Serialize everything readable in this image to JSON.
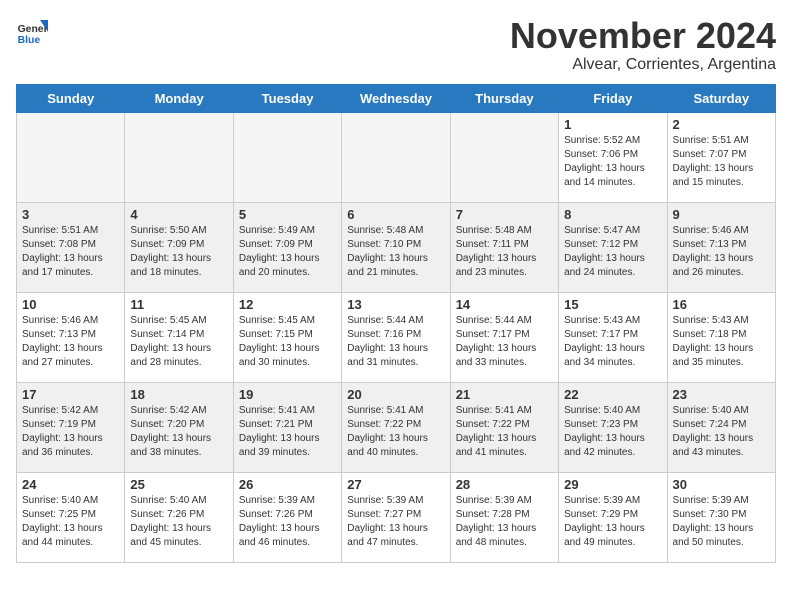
{
  "logo": {
    "general": "General",
    "blue": "Blue"
  },
  "title": "November 2024",
  "subtitle": "Alvear, Corrientes, Argentina",
  "days": [
    "Sunday",
    "Monday",
    "Tuesday",
    "Wednesday",
    "Thursday",
    "Friday",
    "Saturday"
  ],
  "weeks": [
    [
      {
        "day": "",
        "info": ""
      },
      {
        "day": "",
        "info": ""
      },
      {
        "day": "",
        "info": ""
      },
      {
        "day": "",
        "info": ""
      },
      {
        "day": "",
        "info": ""
      },
      {
        "day": "1",
        "info": "Sunrise: 5:52 AM\nSunset: 7:06 PM\nDaylight: 13 hours\nand 14 minutes."
      },
      {
        "day": "2",
        "info": "Sunrise: 5:51 AM\nSunset: 7:07 PM\nDaylight: 13 hours\nand 15 minutes."
      }
    ],
    [
      {
        "day": "3",
        "info": "Sunrise: 5:51 AM\nSunset: 7:08 PM\nDaylight: 13 hours\nand 17 minutes."
      },
      {
        "day": "4",
        "info": "Sunrise: 5:50 AM\nSunset: 7:09 PM\nDaylight: 13 hours\nand 18 minutes."
      },
      {
        "day": "5",
        "info": "Sunrise: 5:49 AM\nSunset: 7:09 PM\nDaylight: 13 hours\nand 20 minutes."
      },
      {
        "day": "6",
        "info": "Sunrise: 5:48 AM\nSunset: 7:10 PM\nDaylight: 13 hours\nand 21 minutes."
      },
      {
        "day": "7",
        "info": "Sunrise: 5:48 AM\nSunset: 7:11 PM\nDaylight: 13 hours\nand 23 minutes."
      },
      {
        "day": "8",
        "info": "Sunrise: 5:47 AM\nSunset: 7:12 PM\nDaylight: 13 hours\nand 24 minutes."
      },
      {
        "day": "9",
        "info": "Sunrise: 5:46 AM\nSunset: 7:13 PM\nDaylight: 13 hours\nand 26 minutes."
      }
    ],
    [
      {
        "day": "10",
        "info": "Sunrise: 5:46 AM\nSunset: 7:13 PM\nDaylight: 13 hours\nand 27 minutes."
      },
      {
        "day": "11",
        "info": "Sunrise: 5:45 AM\nSunset: 7:14 PM\nDaylight: 13 hours\nand 28 minutes."
      },
      {
        "day": "12",
        "info": "Sunrise: 5:45 AM\nSunset: 7:15 PM\nDaylight: 13 hours\nand 30 minutes."
      },
      {
        "day": "13",
        "info": "Sunrise: 5:44 AM\nSunset: 7:16 PM\nDaylight: 13 hours\nand 31 minutes."
      },
      {
        "day": "14",
        "info": "Sunrise: 5:44 AM\nSunset: 7:17 PM\nDaylight: 13 hours\nand 33 minutes."
      },
      {
        "day": "15",
        "info": "Sunrise: 5:43 AM\nSunset: 7:17 PM\nDaylight: 13 hours\nand 34 minutes."
      },
      {
        "day": "16",
        "info": "Sunrise: 5:43 AM\nSunset: 7:18 PM\nDaylight: 13 hours\nand 35 minutes."
      }
    ],
    [
      {
        "day": "17",
        "info": "Sunrise: 5:42 AM\nSunset: 7:19 PM\nDaylight: 13 hours\nand 36 minutes."
      },
      {
        "day": "18",
        "info": "Sunrise: 5:42 AM\nSunset: 7:20 PM\nDaylight: 13 hours\nand 38 minutes."
      },
      {
        "day": "19",
        "info": "Sunrise: 5:41 AM\nSunset: 7:21 PM\nDaylight: 13 hours\nand 39 minutes."
      },
      {
        "day": "20",
        "info": "Sunrise: 5:41 AM\nSunset: 7:22 PM\nDaylight: 13 hours\nand 40 minutes."
      },
      {
        "day": "21",
        "info": "Sunrise: 5:41 AM\nSunset: 7:22 PM\nDaylight: 13 hours\nand 41 minutes."
      },
      {
        "day": "22",
        "info": "Sunrise: 5:40 AM\nSunset: 7:23 PM\nDaylight: 13 hours\nand 42 minutes."
      },
      {
        "day": "23",
        "info": "Sunrise: 5:40 AM\nSunset: 7:24 PM\nDaylight: 13 hours\nand 43 minutes."
      }
    ],
    [
      {
        "day": "24",
        "info": "Sunrise: 5:40 AM\nSunset: 7:25 PM\nDaylight: 13 hours\nand 44 minutes."
      },
      {
        "day": "25",
        "info": "Sunrise: 5:40 AM\nSunset: 7:26 PM\nDaylight: 13 hours\nand 45 minutes."
      },
      {
        "day": "26",
        "info": "Sunrise: 5:39 AM\nSunset: 7:26 PM\nDaylight: 13 hours\nand 46 minutes."
      },
      {
        "day": "27",
        "info": "Sunrise: 5:39 AM\nSunset: 7:27 PM\nDaylight: 13 hours\nand 47 minutes."
      },
      {
        "day": "28",
        "info": "Sunrise: 5:39 AM\nSunset: 7:28 PM\nDaylight: 13 hours\nand 48 minutes."
      },
      {
        "day": "29",
        "info": "Sunrise: 5:39 AM\nSunset: 7:29 PM\nDaylight: 13 hours\nand 49 minutes."
      },
      {
        "day": "30",
        "info": "Sunrise: 5:39 AM\nSunset: 7:30 PM\nDaylight: 13 hours\nand 50 minutes."
      }
    ]
  ]
}
